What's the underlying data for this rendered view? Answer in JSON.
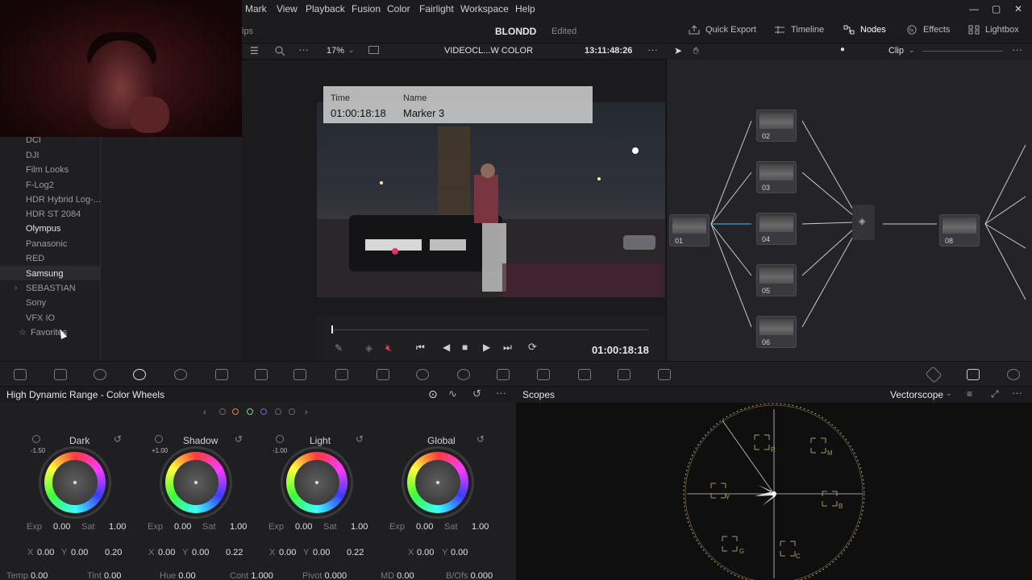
{
  "menu": [
    "Mark",
    "View",
    "Playback",
    "Fusion",
    "Color",
    "Fairlight",
    "Workspace",
    "Help"
  ],
  "window_controls": {
    "minimize": "—",
    "maximize": "▢",
    "close": "✕"
  },
  "header": {
    "left_fragment": "ips",
    "project_title": "BLONDD",
    "project_status": "Edited",
    "quick_export": "Quick Export",
    "timeline": "Timeline",
    "nodes": "Nodes",
    "effects": "Effects",
    "lightbox": "Lightbox"
  },
  "viewer": {
    "zoom": "17%",
    "clip_name": "VIDEOCL...W COLOR",
    "timecode_top": "13:11:48:26",
    "timecode_bottom": "01:00:18:18",
    "marker": {
      "time_label": "Time",
      "time_value": "01:00:18:18",
      "name_label": "Name",
      "name_value": "Marker 3"
    }
  },
  "node_editor": {
    "mode": "Clip",
    "nodes": [
      "01",
      "02",
      "03",
      "04",
      "05",
      "06",
      "08"
    ]
  },
  "lut_list": [
    {
      "label": "DCI",
      "bright": false
    },
    {
      "label": "DJI",
      "bright": false
    },
    {
      "label": "Film Looks",
      "bright": false
    },
    {
      "label": "F-Log2",
      "bright": false
    },
    {
      "label": "HDR Hybrid Log-...",
      "bright": false
    },
    {
      "label": "HDR ST 2084",
      "bright": false
    },
    {
      "label": "Olympus",
      "bright": true
    },
    {
      "label": "Panasonic",
      "bright": false
    },
    {
      "label": "RED",
      "bright": false
    },
    {
      "label": "Samsung",
      "bright": true
    },
    {
      "label": "SEBASTIAN",
      "bright": false
    },
    {
      "label": "Sony",
      "bright": false
    },
    {
      "label": "VFX IO",
      "bright": false
    },
    {
      "label": "Favorites",
      "bright": false
    }
  ],
  "wheels_panel": {
    "title": "High Dynamic Range - Color Wheels",
    "wheels": [
      {
        "name": "Dark",
        "zone": "-1.50",
        "exp": "0.00",
        "sat": "1.00",
        "x": "0.00",
        "y": "0.00",
        "third_label": "Fall",
        "third": "0.20"
      },
      {
        "name": "Shadow",
        "zone": "+1.00",
        "exp": "0.00",
        "sat": "1.00",
        "x": "0.00",
        "y": "0.00",
        "third_label": "Fall",
        "third": "0.22"
      },
      {
        "name": "Light",
        "zone": "-1.00",
        "exp": "0.00",
        "sat": "1.00",
        "x": "0.00",
        "y": "0.00",
        "third_label": "Fall",
        "third": "0.22"
      },
      {
        "name": "Global",
        "zone": "",
        "exp": "0.00",
        "sat": "1.00",
        "x": "0.00",
        "y": "0.00",
        "third_label": "",
        "third": ""
      }
    ],
    "bottom_row": [
      {
        "k": "Temp",
        "v": "0.00"
      },
      {
        "k": "Tint",
        "v": "0.00"
      },
      {
        "k": "Hue",
        "v": "0.00"
      },
      {
        "k": "Cont",
        "v": "1.000"
      },
      {
        "k": "Pivot",
        "v": "0.000"
      },
      {
        "k": "MD",
        "v": "0.00"
      },
      {
        "k": "B/Ofs",
        "v": "0.000"
      }
    ],
    "labels": {
      "exp": "Exp",
      "sat": "Sat",
      "x": "X",
      "y": "Y"
    }
  },
  "scopes": {
    "title": "Scopes",
    "mode": "Vectorscope",
    "targets": [
      "R",
      "M",
      "B",
      "C",
      "G",
      "Y"
    ]
  },
  "colors": {
    "accent": "#e04040",
    "node_link": "#c9c9c9",
    "node_port_green": "#8fd14f",
    "node_port_blue": "#4fb7f0"
  }
}
